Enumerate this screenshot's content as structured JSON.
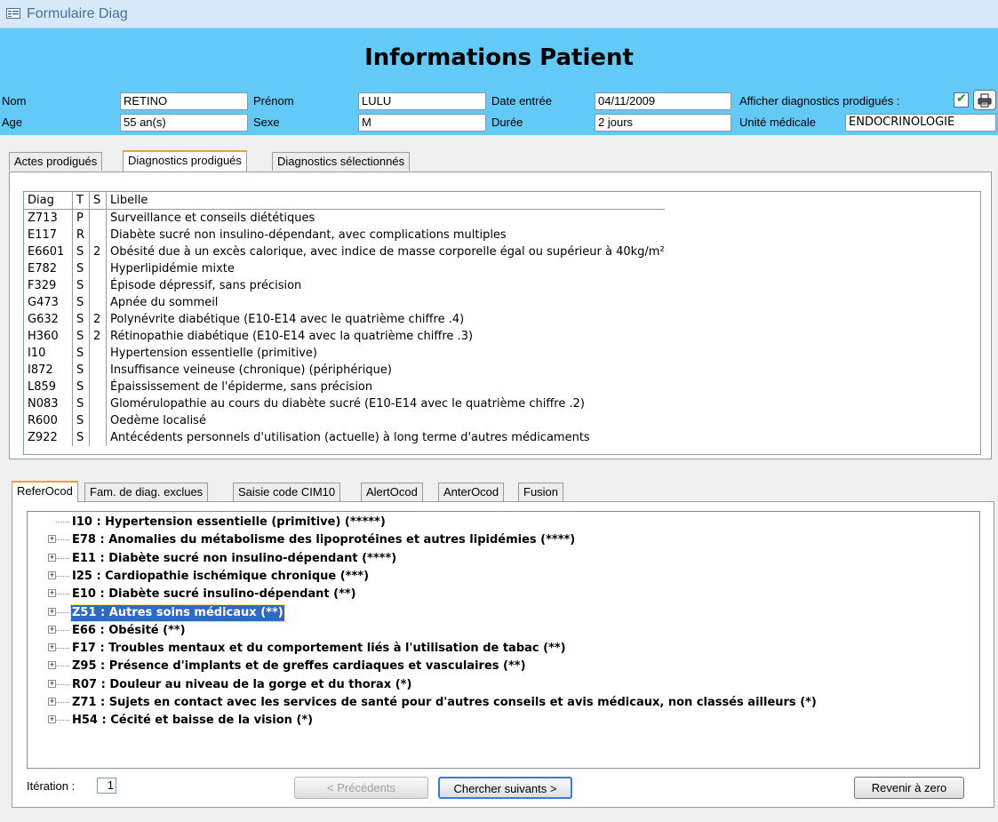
{
  "window": {
    "title": "Formulaire Diag"
  },
  "header": {
    "title": "Informations Patient"
  },
  "patient": {
    "nom_label": "Nom",
    "nom": "RETINO",
    "prenom_label": "Prénom",
    "prenom": "LULU",
    "date_entree_label": "Date entrée",
    "date_entree": "04/11/2009",
    "afficher_label": "Afficher diagnostics prodigués :",
    "afficher_checked": true,
    "age_label": "Age",
    "age": "55 an(s)",
    "sexe_label": "Sexe",
    "sexe": "M",
    "duree_label": "Durée",
    "duree": "2 jours",
    "unite_label": "Unité médicale",
    "unite": "ENDOCRINOLOGIE"
  },
  "top_tabs": [
    {
      "label": "Actes prodigués",
      "active": false
    },
    {
      "label": "Diagnostics prodigués",
      "active": true
    },
    {
      "label": "Diagnostics sélectionnés",
      "active": false
    }
  ],
  "diagnostics_table": {
    "columns": [
      "Diag",
      "T",
      "S",
      "Libelle"
    ],
    "rows": [
      [
        "Z713",
        "P",
        "",
        "Surveillance et conseils diététiques"
      ],
      [
        "E117",
        "R",
        "",
        "Diabète sucré non insulino-dépendant, avec complications multiples"
      ],
      [
        "E6601",
        "S",
        "2",
        "Obésité due à un excès calorique, avec indice de masse corporelle égal ou supérieur à 40kg/m²"
      ],
      [
        "E782",
        "S",
        "",
        "Hyperlipidémie mixte"
      ],
      [
        "F329",
        "S",
        "",
        "Épisode dépressif, sans précision"
      ],
      [
        "G473",
        "S",
        "",
        "Apnée du sommeil"
      ],
      [
        "G632",
        "S",
        "2",
        "Polynévrite diabétique (E10-E14 avec le quatrième chiffre .4)"
      ],
      [
        "H360",
        "S",
        "2",
        "Rétinopathie diabétique (E10-E14 avec la quatrième chiffre .3)"
      ],
      [
        "I10",
        "S",
        "",
        "Hypertension essentielle (primitive)"
      ],
      [
        "I872",
        "S",
        "",
        "Insuffisance veineuse (chronique) (périphérique)"
      ],
      [
        "L859",
        "S",
        "",
        "Épaississement de l'épiderme, sans précision"
      ],
      [
        "N083",
        "S",
        "",
        "Glomérulopathie au cours du diabète sucré (E10-E14 avec le quatrième chiffre .2)"
      ],
      [
        "R600",
        "S",
        "",
        "Oedème localisé"
      ],
      [
        "Z922",
        "S",
        "",
        "Antécédents personnels d'utilisation (actuelle) à long terme d'autres médicaments"
      ]
    ]
  },
  "bottom_tabs": [
    {
      "label": "ReferOcod",
      "active": true
    },
    {
      "label": "Fam. de diag. exclues",
      "active": false
    },
    {
      "label": "Saisie code CIM10",
      "active": false
    },
    {
      "label": "AlertOcod",
      "active": false
    },
    {
      "label": "AnterOcod",
      "active": false
    },
    {
      "label": "Fusion",
      "active": false
    }
  ],
  "tree": [
    {
      "text": "I10 : Hypertension essentielle (primitive) (*****)",
      "expandable": false,
      "selected": false
    },
    {
      "text": "E78 : Anomalies du métabolisme des lipoprotéines et autres lipidémies (****)",
      "expandable": true,
      "selected": false
    },
    {
      "text": "E11 : Diabète sucré non insulino-dépendant (****)",
      "expandable": true,
      "selected": false
    },
    {
      "text": "I25 : Cardiopathie ischémique chronique (***)",
      "expandable": true,
      "selected": false
    },
    {
      "text": "E10 : Diabète sucré insulino-dépendant (**)",
      "expandable": true,
      "selected": false
    },
    {
      "text": "Z51 : Autres soins médicaux (**)",
      "expandable": true,
      "selected": true
    },
    {
      "text": "E66 : Obésité (**)",
      "expandable": true,
      "selected": false
    },
    {
      "text": "F17 : Troubles mentaux et du comportement liés à l'utilisation de tabac (**)",
      "expandable": true,
      "selected": false
    },
    {
      "text": "Z95 : Présence d'implants et de greffes cardiaques et vasculaires (**)",
      "expandable": true,
      "selected": false
    },
    {
      "text": "R07 : Douleur au niveau de la gorge et du thorax (*)",
      "expandable": true,
      "selected": false
    },
    {
      "text": "Z71 : Sujets en contact avec les services de santé pour d'autres conseils et avis médicaux, non classés ailleurs (*)",
      "expandable": true,
      "selected": false
    },
    {
      "text": "H54 : Cécité et baisse de la vision (*)",
      "expandable": true,
      "selected": false
    }
  ],
  "footer": {
    "iteration_label": "Itération :",
    "iteration_value": "1",
    "prev_label": "< Précédents",
    "next_label": "Chercher suivants >",
    "reset_label": "Revenir à zero"
  },
  "icons": {
    "form": "form-icon",
    "print": "printer-icon",
    "check": "checkmark-icon",
    "expand": "plus-box-icon"
  },
  "colors": {
    "header_band": "#63c9f7",
    "selection": "#3168c6",
    "active_tab_accent": "#f0a030",
    "checkmark": "#1d9b1d"
  }
}
